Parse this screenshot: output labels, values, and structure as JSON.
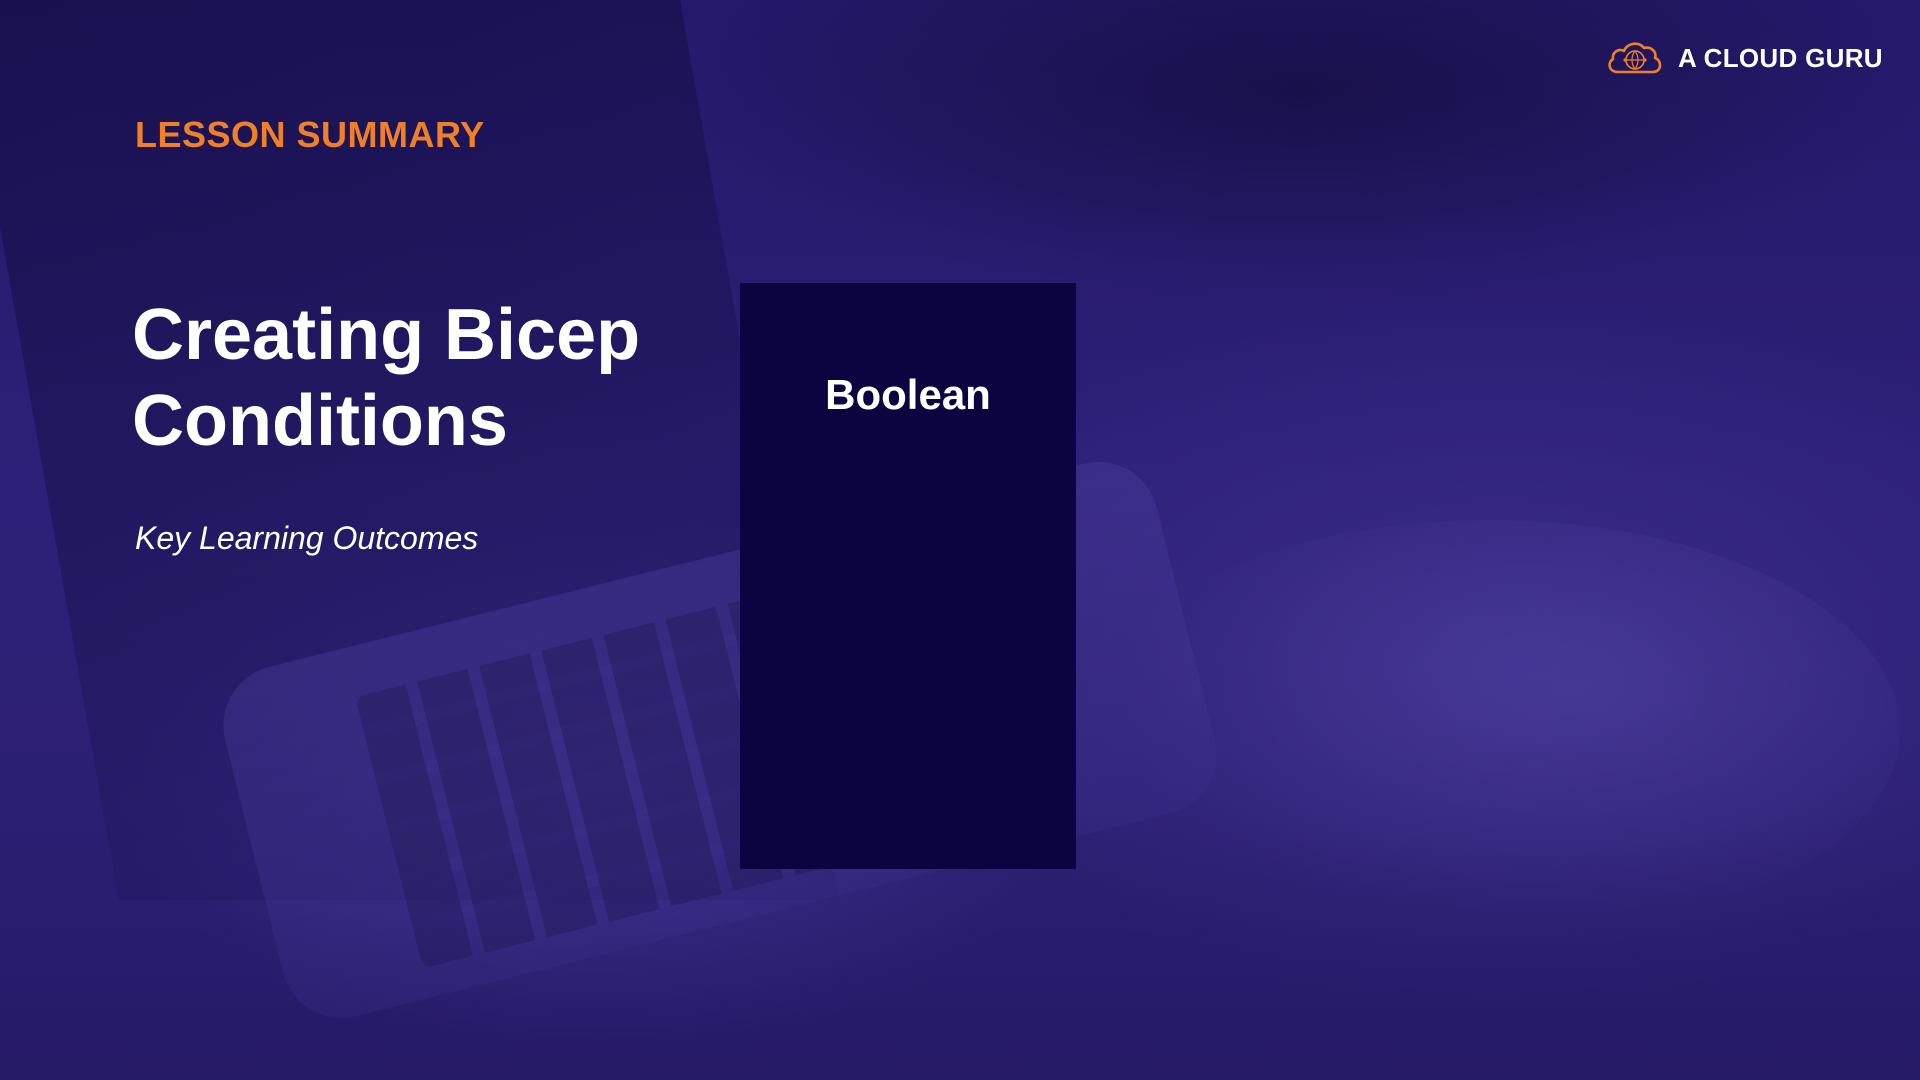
{
  "brand": {
    "name": "A CLOUD GURU",
    "icon": "cloud-logo-icon",
    "accent_color": "#f08028"
  },
  "slide": {
    "section_label": "LESSON SUMMARY",
    "title": "Creating Bicep Conditions",
    "subtitle": "Key Learning Outcomes"
  },
  "card": {
    "label": "Boolean",
    "background_color": "#0c0440"
  },
  "colors": {
    "background": "#2a1d6e",
    "text": "#ffffff"
  }
}
